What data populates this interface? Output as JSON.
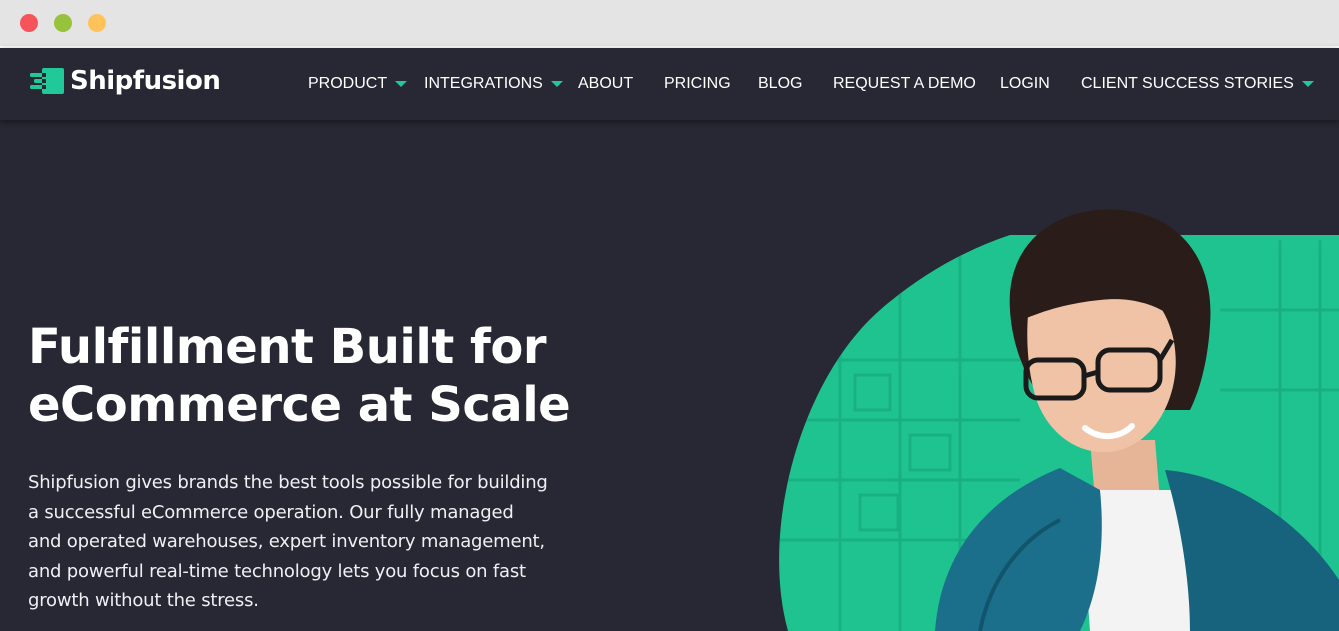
{
  "window": {
    "controls": [
      "close",
      "minimize",
      "zoom"
    ]
  },
  "brand": {
    "name": "Shipfusion",
    "logo_icon": "shipfusion-logo-icon",
    "accent_color": "#20c997",
    "background_color": "#272833"
  },
  "nav": {
    "items": [
      {
        "label": "PRODUCT",
        "has_dropdown": true
      },
      {
        "label": "INTEGRATIONS",
        "has_dropdown": true
      },
      {
        "label": "ABOUT",
        "has_dropdown": false
      },
      {
        "label": "PRICING",
        "has_dropdown": false
      },
      {
        "label": "BLOG",
        "has_dropdown": false
      },
      {
        "label": "REQUEST A DEMO",
        "has_dropdown": false
      },
      {
        "label": "LOGIN",
        "has_dropdown": false
      },
      {
        "label": "CLIENT SUCCESS STORIES",
        "has_dropdown": true
      }
    ]
  },
  "hero": {
    "title_line1": "Fulfillment Built for",
    "title_line2": "eCommerce at Scale",
    "body_lines": [
      "Shipfusion gives brands the best tools possible for building",
      "a successful eCommerce operation. Our fully managed",
      "and operated warehouses, expert inventory management,",
      "and powerful real-time technology lets you focus on fast",
      "growth without the stress."
    ],
    "image": "woman-with-glasses-photo"
  }
}
